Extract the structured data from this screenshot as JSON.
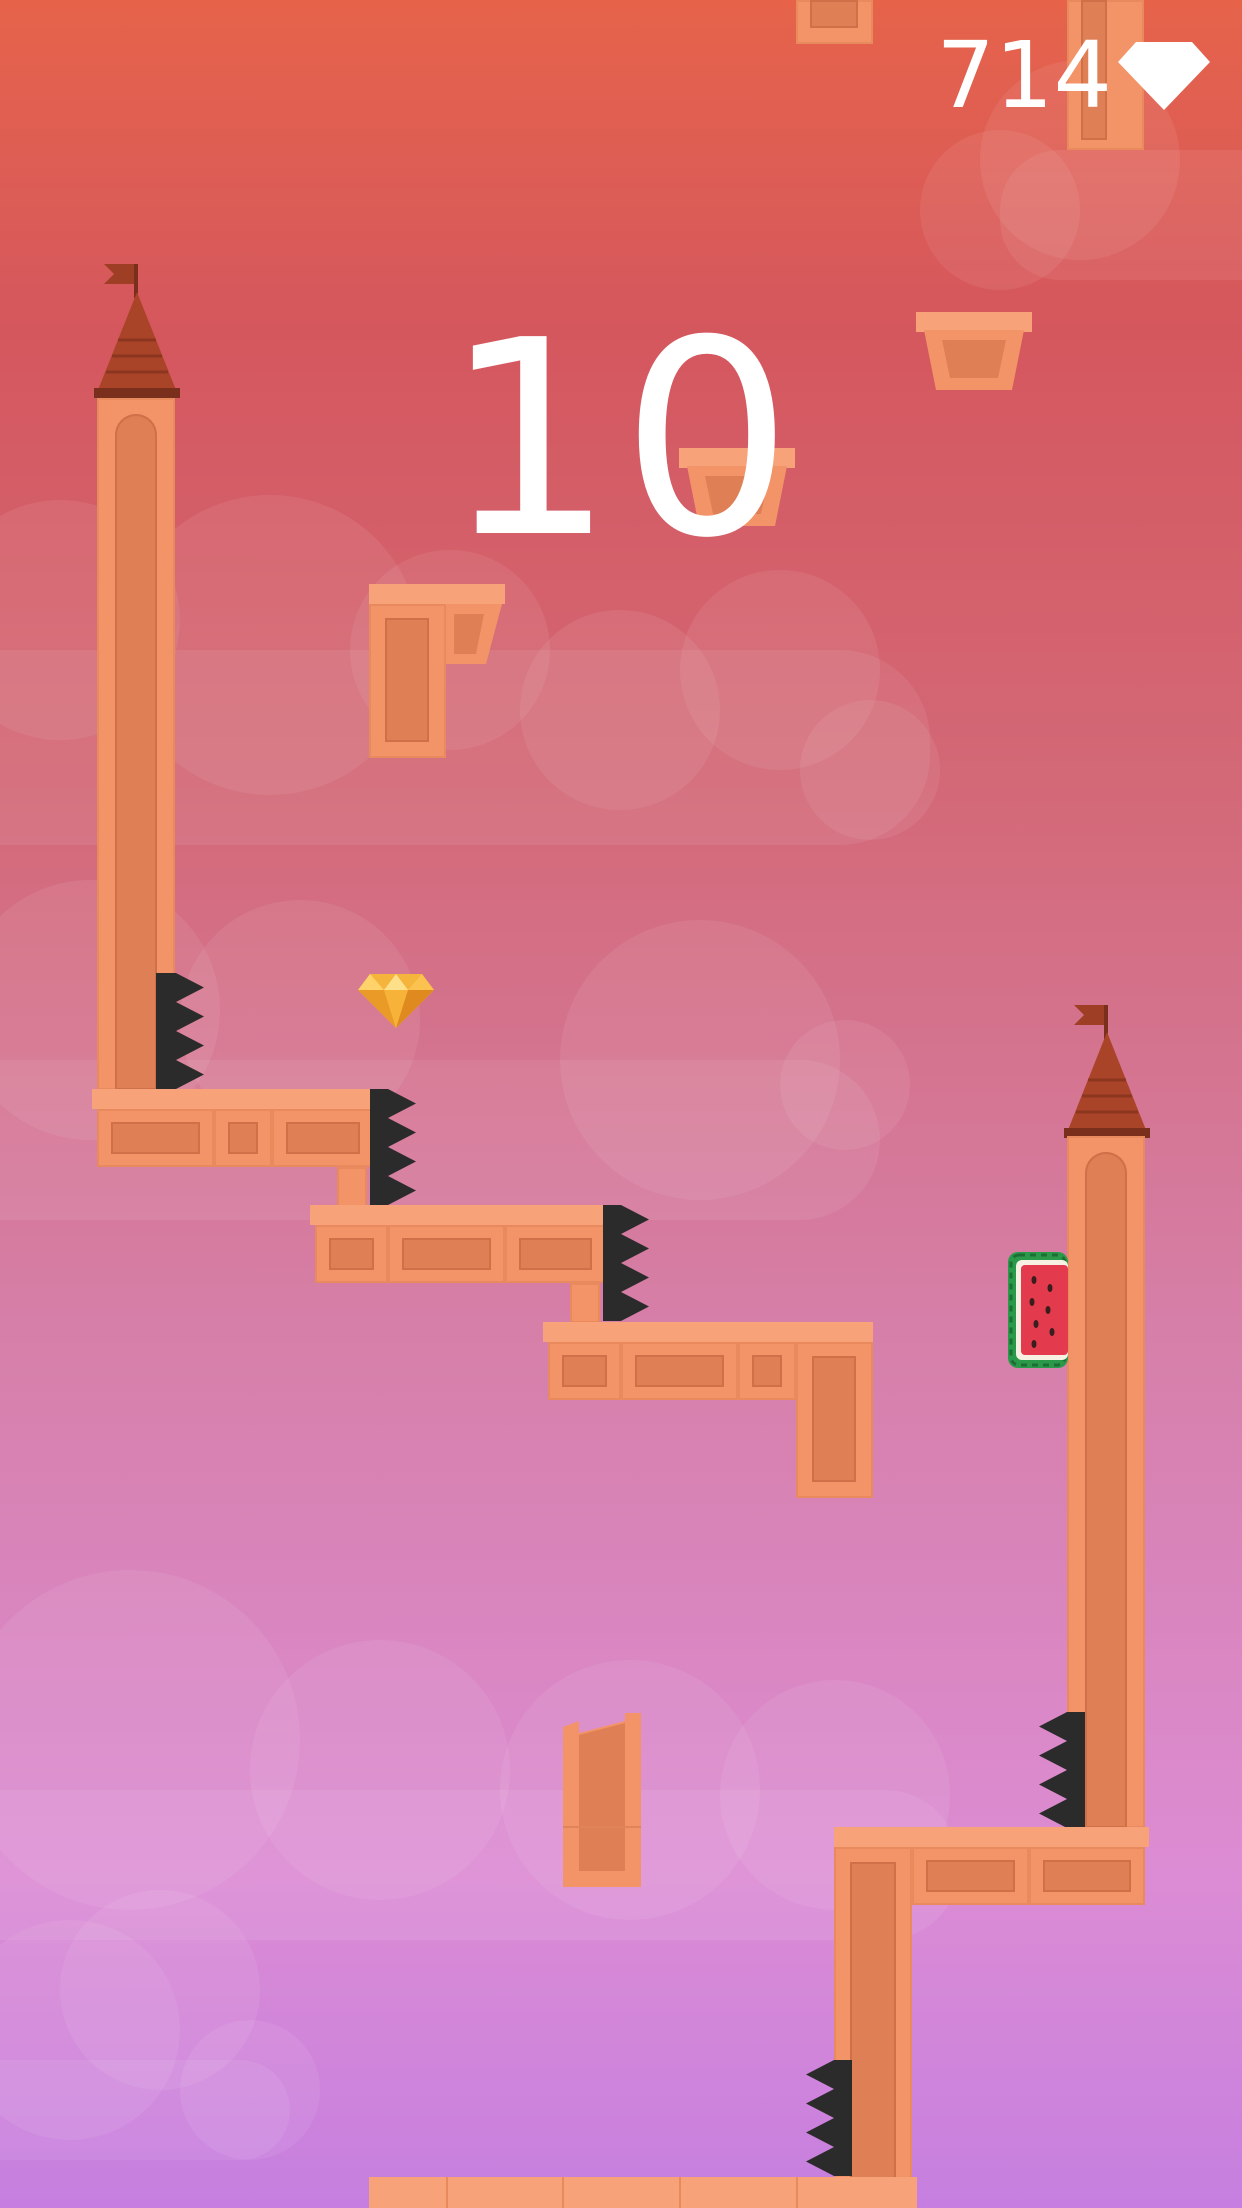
{
  "hud": {
    "score": "10",
    "gems": "714"
  },
  "colors": {
    "sky_top": "#e6634a",
    "sky_bottom": "#c67fe0",
    "brick": "#f29467",
    "brick_dark": "#de7f56",
    "spike": "#2c2b2b",
    "roof": "#9e3e24",
    "gem_hud": "#ffffff",
    "gem_pickup": "#f5b53c",
    "watermelon": "#e33a4e"
  },
  "icons": {
    "gem_counter": "diamond-icon",
    "pickup": "gold-gem-icon",
    "player": "watermelon-icon",
    "flag": "flag-icon"
  }
}
